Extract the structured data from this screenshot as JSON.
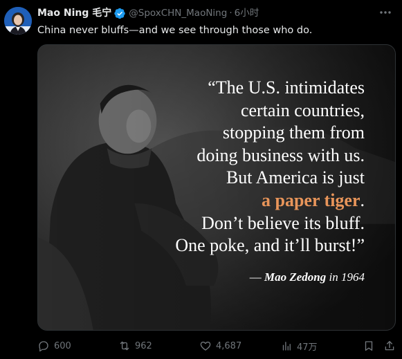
{
  "author": {
    "display_name": "Mao Ning 毛宁",
    "handle": "@SpoxCHN_MaoNing",
    "separator": "·",
    "time": "6小时",
    "avatar_icon": "profile-avatar"
  },
  "tweet": {
    "text": "China never bluffs—and we see through those who do."
  },
  "media": {
    "quote_lines": [
      "“The U.S. intimidates",
      "certain countries,",
      "stopping them from",
      "doing business with us.",
      "But America is just"
    ],
    "highlight": "a paper tiger",
    "highlight_suffix": ".",
    "quote_lines_after": [
      "Don’t believe its bluff.",
      "One poke, and it’ll burst!”"
    ],
    "attribution_dash": "—",
    "attribution_author": "Mao Zedong",
    "attribution_year": "in 1964",
    "highlight_color": "#e8955a"
  },
  "actions": {
    "replies": "600",
    "reposts": "962",
    "likes": "4,687",
    "views": "47万"
  },
  "colors": {
    "background": "#000000",
    "text": "#e7e9ea",
    "secondary": "#71767b",
    "verified": "#1d9bf0"
  }
}
